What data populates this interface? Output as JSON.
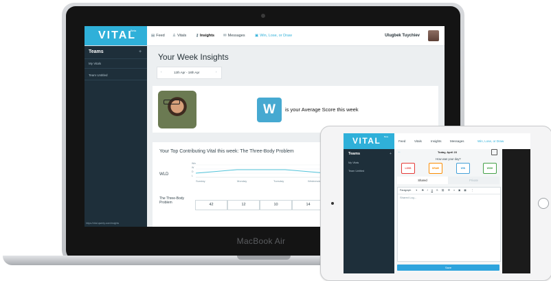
{
  "laptop": {
    "device_label": "MacBook Air",
    "app": {
      "logo": "VITAL",
      "logo_sup": "Beta",
      "nav": [
        {
          "label": "Feed",
          "icon": "feed-icon",
          "glyph": "▤"
        },
        {
          "label": "Vitals",
          "icon": "user-icon",
          "glyph": "♙"
        },
        {
          "label": "Insights",
          "icon": "key-icon",
          "glyph": "⚷"
        },
        {
          "label": "Messages",
          "icon": "chat-icon",
          "glyph": "✉"
        },
        {
          "label": "Win, Lose, or Draw",
          "icon": "calendar-icon",
          "glyph": "▣"
        }
      ],
      "user_name": "Ulugbek Tuychiev"
    },
    "sidebar": {
      "title": "Teams",
      "plus": "+",
      "items": [
        "My Vitals",
        "Team Untitled"
      ],
      "url": "https://vital.qwerty.com/insights"
    },
    "main": {
      "title": "Your Week Insights",
      "date_range": "12th Apr - 18th Apr",
      "prev": "‹",
      "next": "›",
      "score_letter": "W",
      "score_text": "is your Average Score this week",
      "top_vital_title": "Your Top Contributing Vital this week: The Three-Body Problem",
      "wld_label": "WLD",
      "y_ticks": [
        "Win",
        "W",
        "D",
        "L"
      ],
      "x_ticks": [
        "Sunday",
        "Monday",
        "Tuesday",
        "Wednesday"
      ],
      "row_label": "The Three-Body Problem",
      "row_values": [
        "42",
        "12",
        "10",
        "14"
      ]
    }
  },
  "ipad": {
    "app": {
      "logo": "VITAL",
      "logo_sup": "Beta",
      "nav": [
        "Feed",
        "Vitals",
        "Insights",
        "Messages",
        "Win, Lose, or Draw"
      ]
    },
    "sidebar": {
      "title": "Teams",
      "plus": "+",
      "items": [
        "My Vitals",
        "Team Untitled"
      ]
    },
    "main": {
      "back": "←",
      "date": "Today, April 23",
      "question": "How was your day?",
      "buttons": [
        {
          "label": "LOSS",
          "color": "#e53935"
        },
        {
          "label": "DRAW",
          "color": "#fb8c00"
        },
        {
          "label": "WIN",
          "color": "#43a0d8"
        },
        {
          "label": "WISH",
          "color": "#43a047"
        }
      ],
      "tabs": [
        "Shared",
        "Private"
      ],
      "toolbar": "Paragraph",
      "placeholder": "Shared Log...",
      "save": "Save"
    }
  }
}
